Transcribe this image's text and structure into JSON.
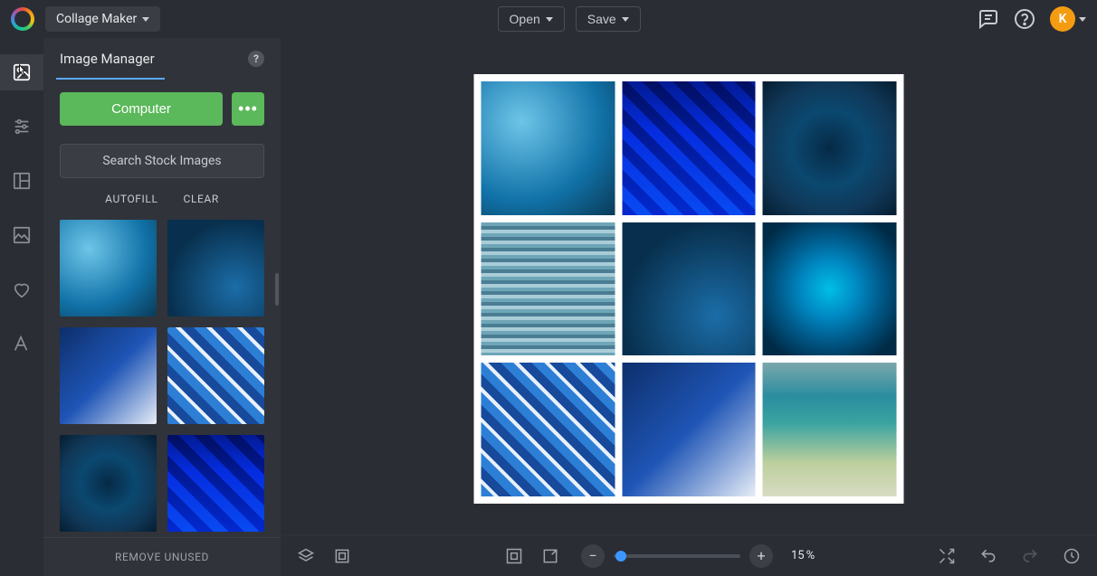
{
  "header": {
    "app_name": "Collage Maker",
    "open_label": "Open",
    "save_label": "Save",
    "avatar_initial": "K"
  },
  "rail": {
    "items": [
      {
        "name": "image-manager",
        "active": true
      },
      {
        "name": "settings",
        "active": false
      },
      {
        "name": "layouts",
        "active": false
      },
      {
        "name": "background",
        "active": false
      },
      {
        "name": "favorites",
        "active": false
      },
      {
        "name": "text",
        "active": false
      }
    ]
  },
  "panel": {
    "title": "Image Manager",
    "computer_btn": "Computer",
    "search_stock": "Search Stock Images",
    "autofill": "AUTOFILL",
    "clear": "CLEAR",
    "remove_unused": "REMOVE UNUSED",
    "thumbs": [
      "sw1",
      "sw2",
      "sw3",
      "sw4",
      "sw5",
      "sw6"
    ]
  },
  "canvas": {
    "cells": [
      "sw1",
      "sw6",
      "sw5",
      "sw7",
      "sw2",
      "sw8",
      "sw4",
      "sw3",
      "sw9"
    ]
  },
  "bottombar": {
    "zoom_percent": "15",
    "zoom_unit": "%"
  }
}
